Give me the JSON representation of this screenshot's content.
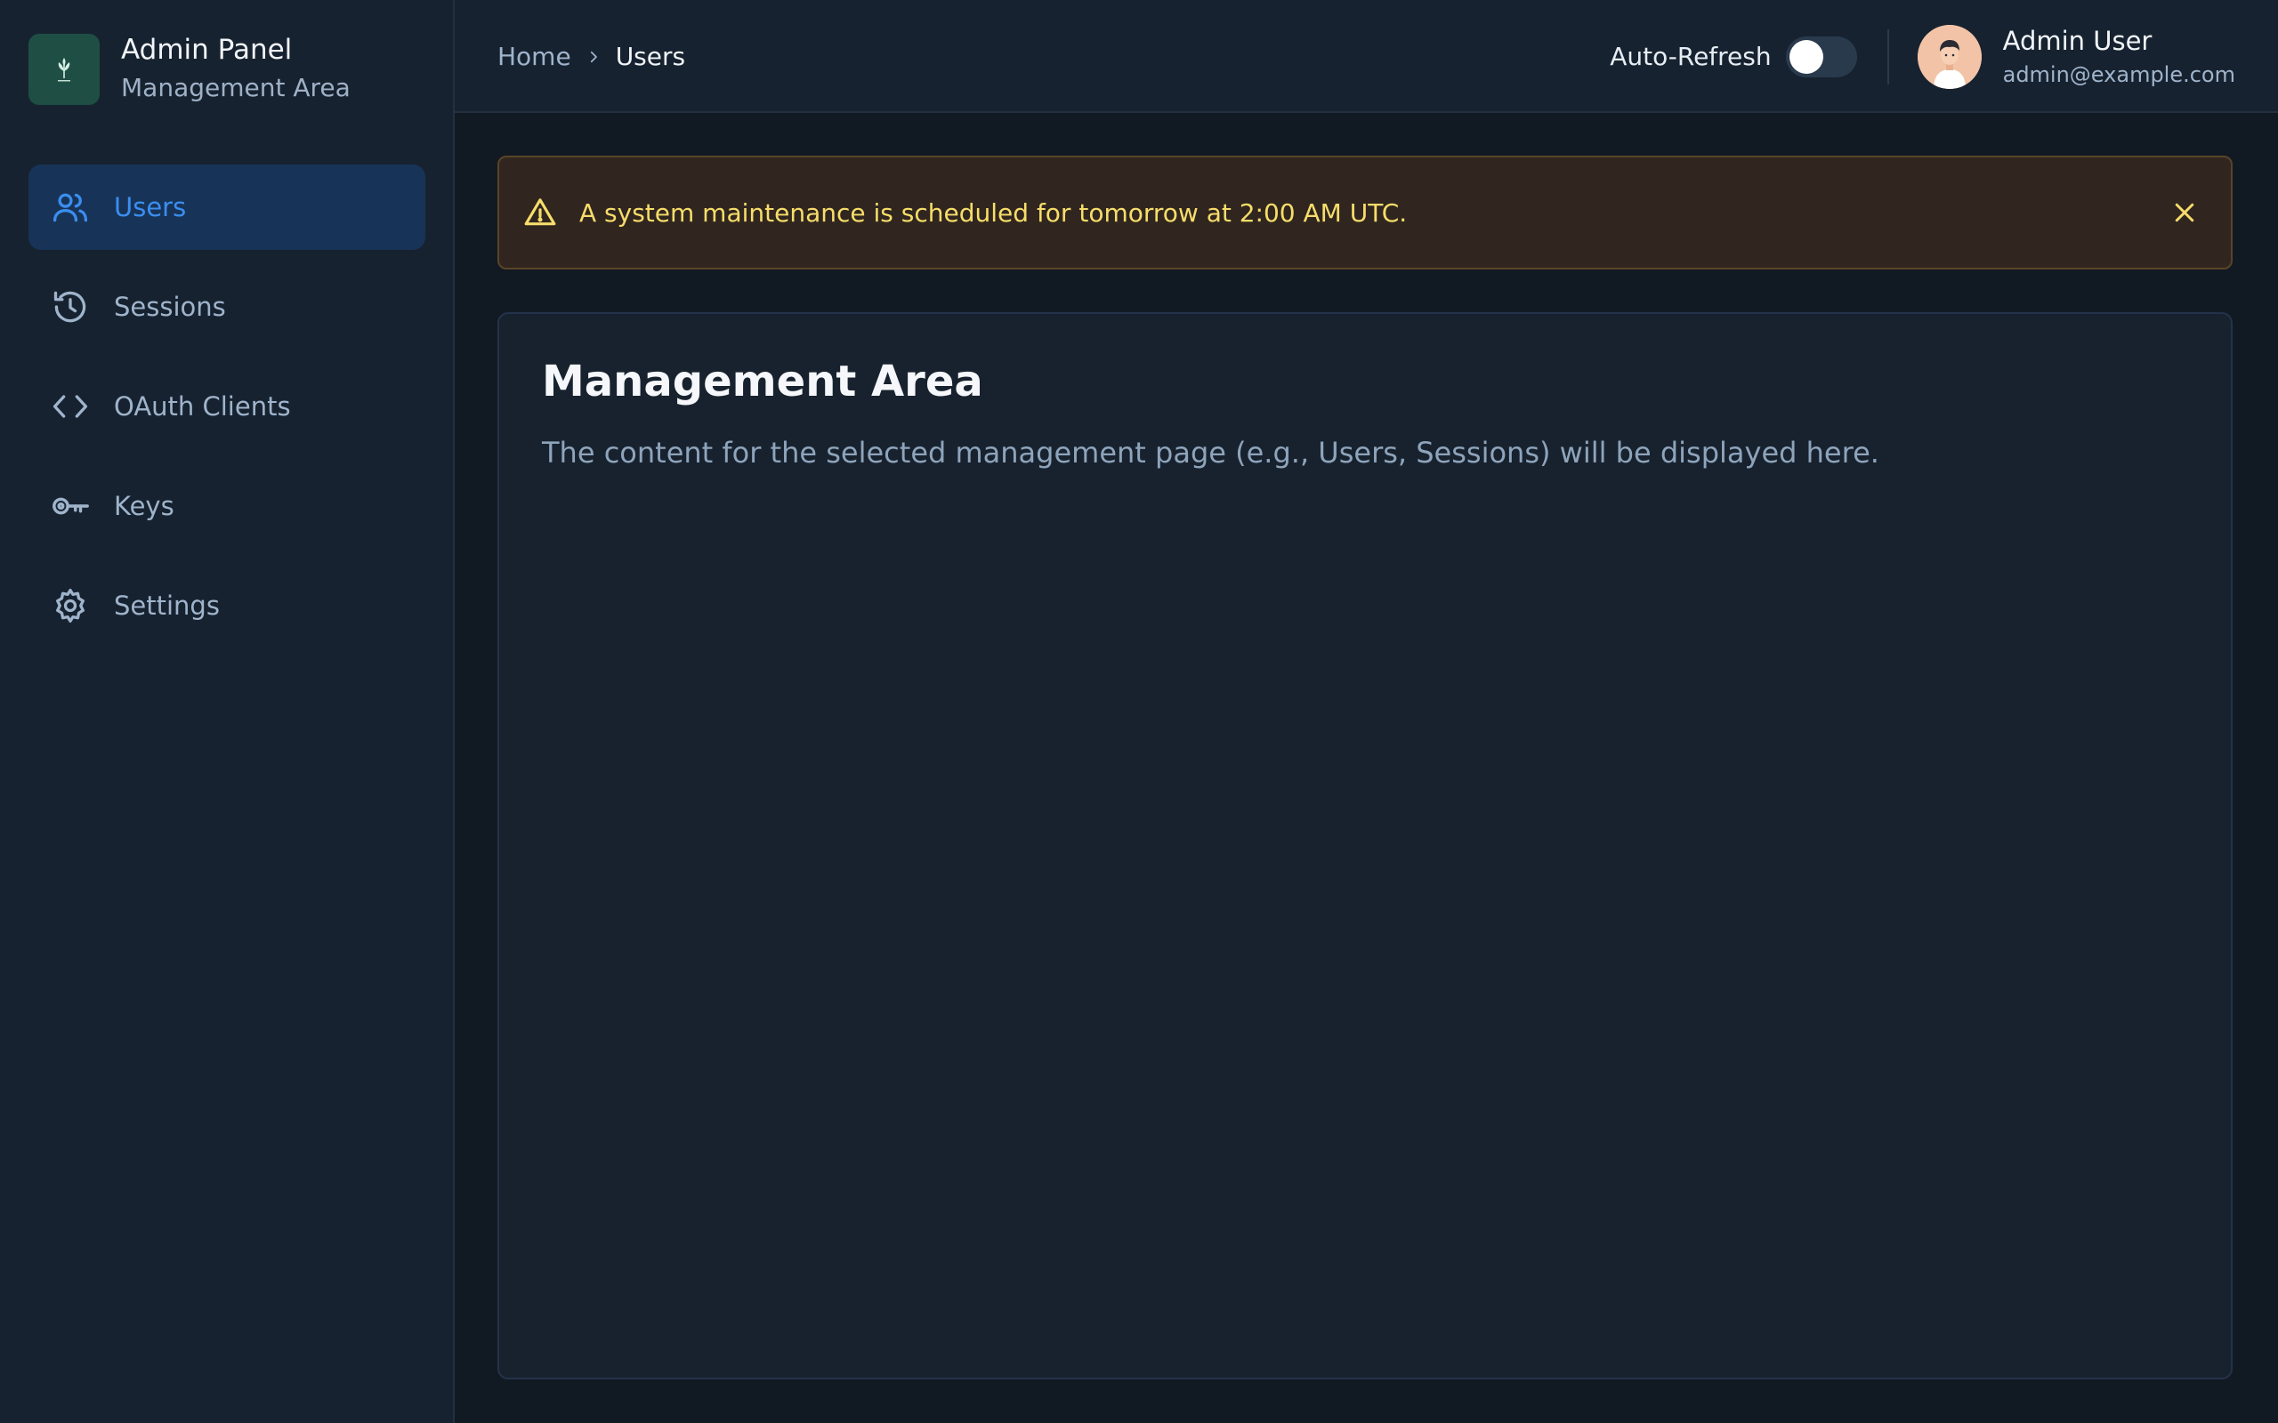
{
  "brand": {
    "title": "Admin Panel",
    "subtitle": "Management Area"
  },
  "sidebar": {
    "items": [
      {
        "label": "Users",
        "icon": "users-icon",
        "active": true
      },
      {
        "label": "Sessions",
        "icon": "history-icon",
        "active": false
      },
      {
        "label": "OAuth Clients",
        "icon": "code-icon",
        "active": false
      },
      {
        "label": "Keys",
        "icon": "key-icon",
        "active": false
      },
      {
        "label": "Settings",
        "icon": "gear-icon",
        "active": false
      }
    ]
  },
  "breadcrumb": {
    "home": "Home",
    "current": "Users"
  },
  "topbar": {
    "auto_refresh_label": "Auto-Refresh",
    "auto_refresh_on": false
  },
  "user": {
    "name": "Admin User",
    "email": "admin@example.com"
  },
  "alert": {
    "text": "A system maintenance is scheduled for tomorrow at 2:00 AM UTC."
  },
  "content": {
    "title": "Management Area",
    "description": "The content for the selected management page (e.g., Users, Sessions) will be displayed here."
  },
  "colors": {
    "accent": "#3b8ef0",
    "active_bg": "#173458",
    "warning_text": "#f7dd6a",
    "warning_bg": "#30261f"
  }
}
